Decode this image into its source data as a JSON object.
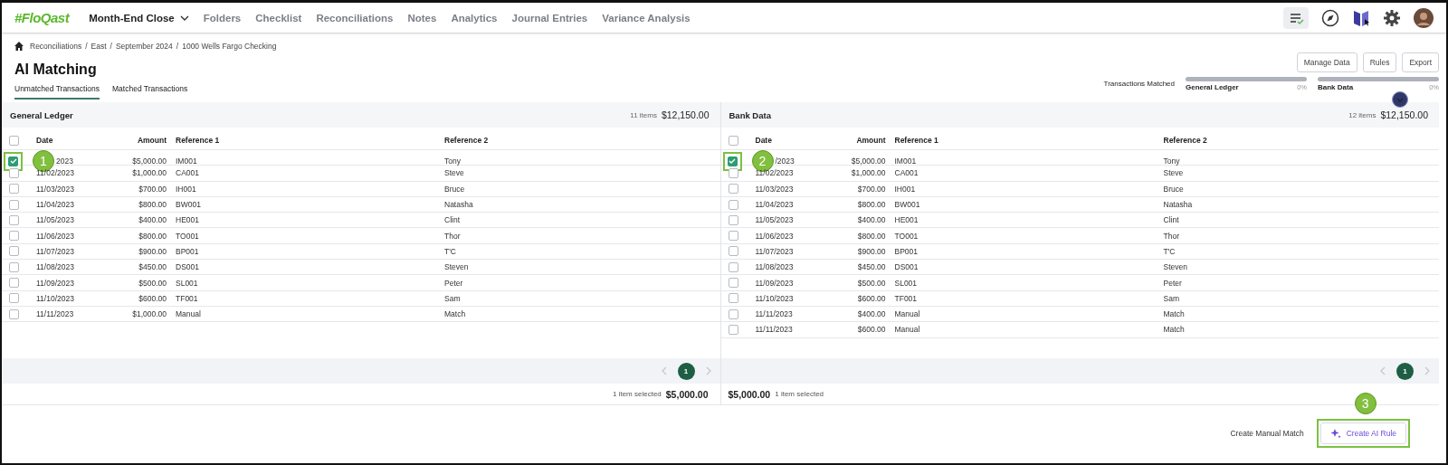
{
  "nav": {
    "logo": "#FloQast",
    "items": [
      {
        "label": "Month-End Close",
        "selected": true,
        "has_menu": true
      },
      {
        "label": "Folders",
        "selected": false,
        "has_menu": false
      },
      {
        "label": "Checklist",
        "selected": false,
        "has_menu": false
      },
      {
        "label": "Reconciliations",
        "selected": false,
        "has_menu": false
      },
      {
        "label": "Notes",
        "selected": false,
        "has_menu": false
      },
      {
        "label": "Analytics",
        "selected": false,
        "has_menu": false
      },
      {
        "label": "Journal Entries",
        "selected": false,
        "has_menu": false
      },
      {
        "label": "Variance Analysis",
        "selected": false,
        "has_menu": false
      }
    ]
  },
  "breadcrumb": [
    {
      "label": "Reconciliations",
      "separator": "/"
    },
    {
      "label": "East",
      "separator": "/"
    },
    {
      "label": "September 2024",
      "separator": "/"
    },
    {
      "label": "1000 Wells Fargo Checking"
    }
  ],
  "title": "AI Matching",
  "tabs": [
    {
      "label": "Unmatched Transactions",
      "selected": true
    },
    {
      "label": "Matched Transactions",
      "selected": false
    }
  ],
  "header_buttons": [
    "Manage Data",
    "Rules",
    "Export"
  ],
  "progress": {
    "label": "Transactions Matched",
    "meters": [
      {
        "name": "General Ledger",
        "level": 0,
        "reading": "0%"
      },
      {
        "name": "Bank Data",
        "level": 0,
        "reading": "0%"
      }
    ]
  },
  "panels": [
    {
      "title": "General Ledger",
      "count": "11 items",
      "total": "$12,150.00",
      "all_checked": false,
      "columns": [
        "Date",
        "Amount",
        "Reference 1",
        "Reference 2"
      ],
      "rows": [
        {
          "checked": true,
          "highlighted": true,
          "callout": "1",
          "date": "2023",
          "amount": "$5,000.00",
          "ref1": "IM001",
          "ref2": "Tony"
        },
        {
          "checked": false,
          "highlighted": false,
          "date": "11/02/2023",
          "amount": "$1,000.00",
          "ref1": "CA001",
          "ref2": "Steve"
        },
        {
          "checked": false,
          "highlighted": false,
          "date": "11/03/2023",
          "amount": "$700.00",
          "ref1": "IH001",
          "ref2": "Bruce"
        },
        {
          "checked": false,
          "highlighted": false,
          "date": "11/04/2023",
          "amount": "$800.00",
          "ref1": "BW001",
          "ref2": "Natasha"
        },
        {
          "checked": false,
          "highlighted": false,
          "date": "11/05/2023",
          "amount": "$400.00",
          "ref1": "HE001",
          "ref2": "Clint"
        },
        {
          "checked": false,
          "highlighted": false,
          "date": "11/06/2023",
          "amount": "$800.00",
          "ref1": "TO001",
          "ref2": "Thor"
        },
        {
          "checked": false,
          "highlighted": false,
          "date": "11/07/2023",
          "amount": "$900.00",
          "ref1": "BP001",
          "ref2": "T'C"
        },
        {
          "checked": false,
          "highlighted": false,
          "date": "11/08/2023",
          "amount": "$450.00",
          "ref1": "DS001",
          "ref2": "Steven"
        },
        {
          "checked": false,
          "highlighted": false,
          "date": "11/09/2023",
          "amount": "$500.00",
          "ref1": "SL001",
          "ref2": "Peter"
        },
        {
          "checked": false,
          "highlighted": false,
          "date": "11/10/2023",
          "amount": "$600.00",
          "ref1": "TF001",
          "ref2": "Sam"
        },
        {
          "checked": false,
          "highlighted": false,
          "date": "11/11/2023",
          "amount": "$1,000.00",
          "ref1": "Manual",
          "ref2": "Match"
        }
      ],
      "page": "1",
      "selected_count": "1 item selected",
      "selected_total": "$5,000.00"
    },
    {
      "title": "Bank Data",
      "count": "12 items",
      "total": "$12,150.00",
      "all_checked": false,
      "columns": [
        "Date",
        "Amount",
        "Reference 1",
        "Reference 2"
      ],
      "rows": [
        {
          "checked": true,
          "highlighted": true,
          "callout": "2",
          "date": "/2023",
          "amount": "$5,000.00",
          "ref1": "IM001",
          "ref2": "Tony"
        },
        {
          "checked": false,
          "highlighted": false,
          "date": "11/02/2023",
          "amount": "$1,000.00",
          "ref1": "CA001",
          "ref2": "Steve"
        },
        {
          "checked": false,
          "highlighted": false,
          "date": "11/03/2023",
          "amount": "$700.00",
          "ref1": "IH001",
          "ref2": "Bruce"
        },
        {
          "checked": false,
          "highlighted": false,
          "date": "11/04/2023",
          "amount": "$800.00",
          "ref1": "BW001",
          "ref2": "Natasha"
        },
        {
          "checked": false,
          "highlighted": false,
          "date": "11/05/2023",
          "amount": "$400.00",
          "ref1": "HE001",
          "ref2": "Clint"
        },
        {
          "checked": false,
          "highlighted": false,
          "date": "11/06/2023",
          "amount": "$800.00",
          "ref1": "TO001",
          "ref2": "Thor"
        },
        {
          "checked": false,
          "highlighted": false,
          "date": "11/07/2023",
          "amount": "$900.00",
          "ref1": "BP001",
          "ref2": "T'C"
        },
        {
          "checked": false,
          "highlighted": false,
          "date": "11/08/2023",
          "amount": "$450.00",
          "ref1": "DS001",
          "ref2": "Steven"
        },
        {
          "checked": false,
          "highlighted": false,
          "date": "11/09/2023",
          "amount": "$500.00",
          "ref1": "SL001",
          "ref2": "Peter"
        },
        {
          "checked": false,
          "highlighted": false,
          "date": "11/10/2023",
          "amount": "$600.00",
          "ref1": "TF001",
          "ref2": "Sam"
        },
        {
          "checked": false,
          "highlighted": false,
          "date": "11/11/2023",
          "amount": "$400.00",
          "ref1": "Manual",
          "ref2": "Match"
        },
        {
          "checked": false,
          "highlighted": false,
          "date": "11/11/2023",
          "amount": "$600.00",
          "ref1": "Manual",
          "ref2": "Match"
        }
      ],
      "page": "1",
      "selected_count": "1 item selected",
      "selected_total": "$5,000.00"
    }
  ],
  "actions": [
    {
      "label": "Create Manual Match",
      "kind": "text",
      "highlighted": false
    },
    {
      "label": "Create AI Rule",
      "kind": "ai",
      "highlighted": true,
      "callout": "3"
    }
  ]
}
